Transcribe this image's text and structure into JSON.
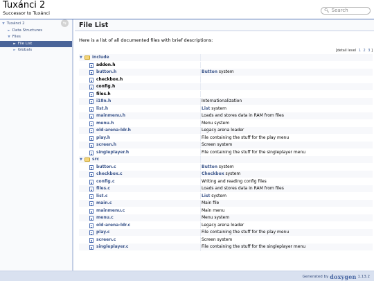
{
  "header": {
    "project_name": "Tuxánci 2",
    "project_brief": "Successor to Tuxánci",
    "search_placeholder": "Search",
    "search_icon": "magnifier-icon"
  },
  "sidebar": {
    "sync_icon": "sync-arrows-icon",
    "items": [
      {
        "label": "Tuxánci 2",
        "arrow": "▼",
        "indent": 0,
        "selected": false
      },
      {
        "label": "Data Structures",
        "arrow": "►",
        "indent": 1,
        "selected": false
      },
      {
        "label": "Files",
        "arrow": "▼",
        "indent": 1,
        "selected": false
      },
      {
        "label": "File List",
        "arrow": "►",
        "indent": 2,
        "selected": true
      },
      {
        "label": "Globals",
        "arrow": "►",
        "indent": 2,
        "selected": false
      }
    ],
    "selected_color": "#4A6499"
  },
  "content": {
    "title": "File List",
    "intro": "Here is a list of all documented files with brief descriptions:",
    "detail_level_label": "[detail level",
    "detail_levels": [
      "1",
      "2",
      "3"
    ],
    "detail_level_close": "]",
    "rows": [
      {
        "type": "dir",
        "name": "include",
        "desc": "",
        "desc_link": ""
      },
      {
        "type": "file",
        "name": "addon.h",
        "desc": "",
        "desc_link": "",
        "plain": true
      },
      {
        "type": "file",
        "name": "button.h",
        "desc_link": "Button",
        "desc": " system"
      },
      {
        "type": "file",
        "name": "checkbox.h",
        "desc": "",
        "desc_link": "",
        "plain": true
      },
      {
        "type": "file",
        "name": "config.h",
        "desc": "",
        "desc_link": "",
        "plain": true
      },
      {
        "type": "file",
        "name": "files.h",
        "desc": "",
        "desc_link": "",
        "plain": true
      },
      {
        "type": "file",
        "name": "i18n.h",
        "desc_link": "",
        "desc": "Internationalization"
      },
      {
        "type": "file",
        "name": "list.h",
        "desc_link": "List",
        "desc": " system"
      },
      {
        "type": "file",
        "name": "mainmenu.h",
        "desc_link": "",
        "desc": "Loads and stores data in RAM from files"
      },
      {
        "type": "file",
        "name": "menu.h",
        "desc_link": "",
        "desc": "Menu system"
      },
      {
        "type": "file",
        "name": "old-arena-ldr.h",
        "desc_link": "",
        "desc": "Legacy arena loader"
      },
      {
        "type": "file",
        "name": "play.h",
        "desc_link": "",
        "desc": "File containing the stuff for the play menu"
      },
      {
        "type": "file",
        "name": "screen.h",
        "desc_link": "",
        "desc": "Screen system"
      },
      {
        "type": "file",
        "name": "singleplayer.h",
        "desc_link": "",
        "desc": "File containing the stuff for the singleplayer menu"
      },
      {
        "type": "dir",
        "name": "src",
        "desc": "",
        "desc_link": ""
      },
      {
        "type": "file",
        "name": "button.c",
        "desc_link": "Button",
        "desc": " system"
      },
      {
        "type": "file",
        "name": "checkbox.c",
        "desc_link": "Checkbox",
        "desc": " system"
      },
      {
        "type": "file",
        "name": "config.c",
        "desc_link": "",
        "desc": "Writing and reading config files"
      },
      {
        "type": "file",
        "name": "files.c",
        "desc_link": "",
        "desc": "Loads and stores data in RAM from files"
      },
      {
        "type": "file",
        "name": "list.c",
        "desc_link": "List",
        "desc": " system"
      },
      {
        "type": "file",
        "name": "main.c",
        "desc_link": "",
        "desc": "Main file"
      },
      {
        "type": "file",
        "name": "mainmenu.c",
        "desc_link": "",
        "desc": "Main menu"
      },
      {
        "type": "file",
        "name": "menu.c",
        "desc_link": "",
        "desc": "Menu system"
      },
      {
        "type": "file",
        "name": "old-arena-ldr.c",
        "desc_link": "",
        "desc": "Legacy arena loader"
      },
      {
        "type": "file",
        "name": "play.c",
        "desc_link": "",
        "desc": "File containing the stuff for the play menu"
      },
      {
        "type": "file",
        "name": "screen.c",
        "desc_link": "",
        "desc": "Screen system"
      },
      {
        "type": "file",
        "name": "singleplayer.c",
        "desc_link": "",
        "desc": "File containing the stuff for the singleplayer menu"
      }
    ]
  },
  "footer": {
    "generated_by": "Generated by",
    "logo_text": "doxygen",
    "version": "1.13.2"
  },
  "colors": {
    "link": "#3D578C",
    "nav_background": "#F9FAFC",
    "footer_background": "#D9E1F0",
    "folder": "#F5D57A"
  }
}
